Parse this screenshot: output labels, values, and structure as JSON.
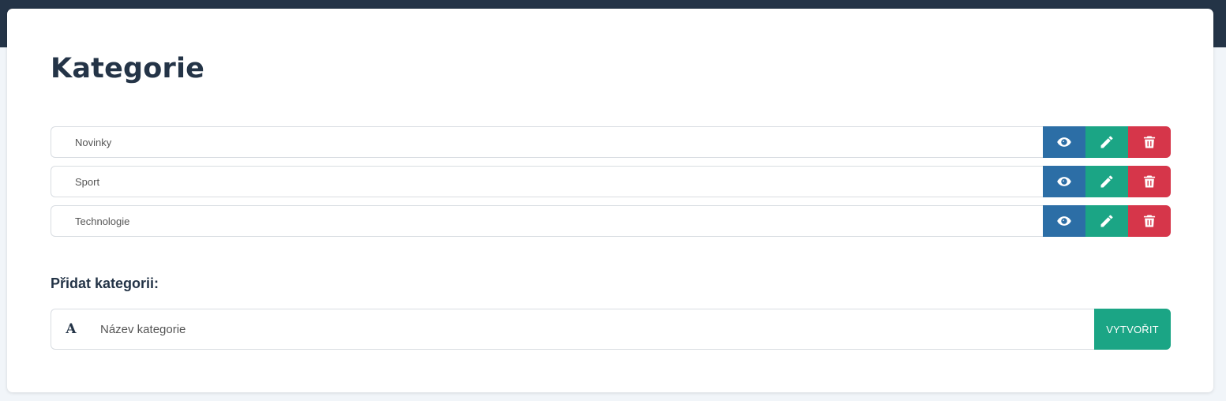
{
  "header": {
    "title": "Kategorie"
  },
  "categories": [
    {
      "name": "Novinky"
    },
    {
      "name": "Sport"
    },
    {
      "name": "Technologie"
    }
  ],
  "row_actions": {
    "view_icon": "eye-icon",
    "edit_icon": "pencil-icon",
    "delete_icon": "trash-icon"
  },
  "add_form": {
    "label": "Přidat kategorii:",
    "input_icon": "font-icon",
    "input_icon_glyph": "A",
    "placeholder": "Název kategorie",
    "value": "",
    "submit_label": "VYTVOŘIT"
  },
  "colors": {
    "topbar": "#243447",
    "view": "#2c6ea6",
    "edit": "#1ba585",
    "delete": "#d6364a",
    "submit": "#1ba585"
  }
}
